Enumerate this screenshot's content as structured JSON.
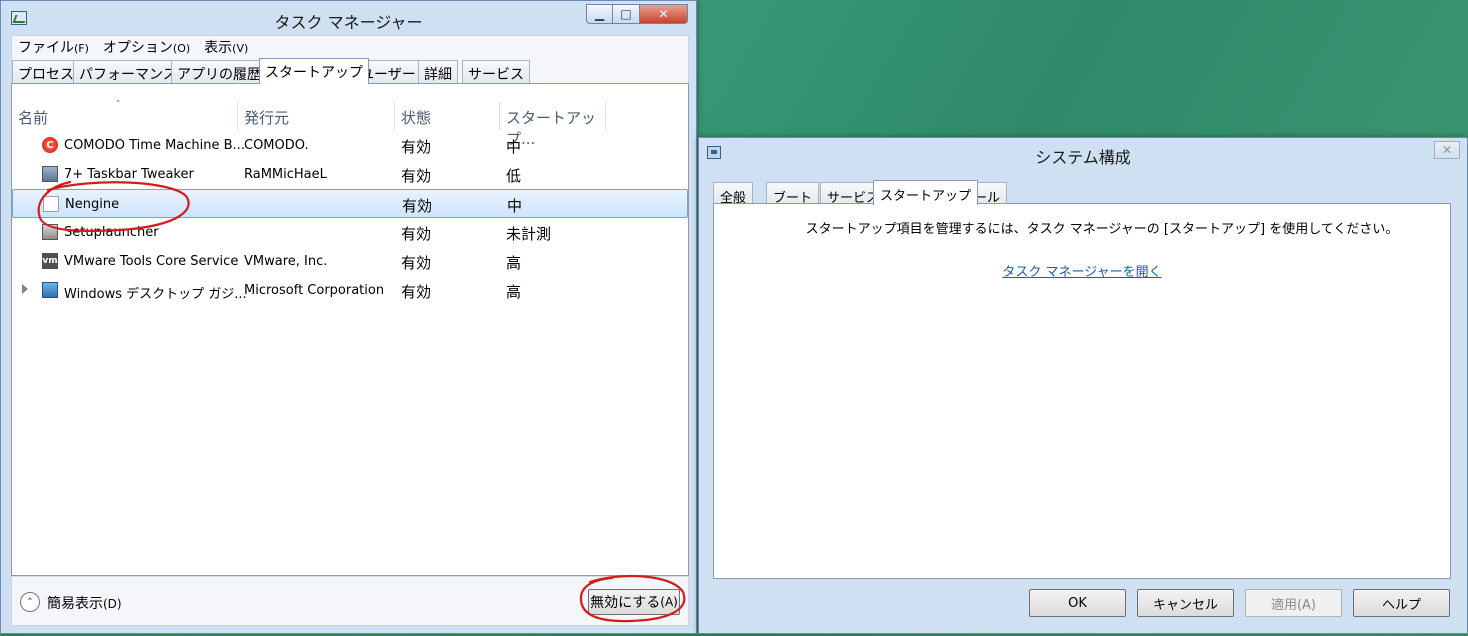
{
  "task_manager": {
    "title": "タスク マネージャー",
    "caption_buttons": {
      "minimize": "▁",
      "maximize": "□",
      "close": "✕"
    },
    "menu": [
      {
        "label": "ファイル",
        "accel": "(F)"
      },
      {
        "label": "オプション",
        "accel": "(O)"
      },
      {
        "label": "表示",
        "accel": "(V)"
      }
    ],
    "tabs": [
      "プロセス",
      "パフォーマンス",
      "アプリの履歴",
      "スタートアップ",
      "ユーザー",
      "詳細",
      "サービス"
    ],
    "active_tab": "スタートアップ",
    "columns": {
      "name": "名前",
      "publisher": "発行元",
      "status": "状態",
      "impact": "スタートアップ..."
    },
    "sort_indicator": "˄",
    "rows": [
      {
        "name": "COMODO Time Machine B...",
        "publisher": "COMODO.",
        "status": "有効",
        "impact": "中",
        "icon": "comodo-icon",
        "icon_glyph": "C"
      },
      {
        "name": "7+ Taskbar Tweaker",
        "publisher": "RaMMicHaeL",
        "status": "有効",
        "impact": "低",
        "icon": "taskbar-tweaker-icon",
        "icon_glyph": ""
      },
      {
        "name": "Nengine",
        "publisher": "",
        "status": "有効",
        "impact": "中",
        "icon": "file-icon",
        "icon_glyph": ""
      },
      {
        "name": "Setuplauncher",
        "publisher": "",
        "status": "有効",
        "impact": "未計測",
        "icon": "setup-launcher-icon",
        "icon_glyph": ""
      },
      {
        "name": "VMware Tools Core Service",
        "publisher": "VMware, Inc.",
        "status": "有効",
        "impact": "高",
        "icon": "vmware-icon",
        "icon_glyph": "vm"
      },
      {
        "name": "Windows デスクトップ ガジ...",
        "publisher": "Microsoft Corporation",
        "status": "有効",
        "impact": "高",
        "icon": "desktop-gadget-icon",
        "icon_glyph": ""
      }
    ],
    "selected_row_index": 2,
    "footer": {
      "fewer_details": "簡易表示",
      "fewer_details_accel": "(D)",
      "fewer_details_glyph": "˄",
      "disable_button": "無効にする",
      "disable_button_accel": "(A)"
    }
  },
  "system_config": {
    "title": "システム構成",
    "close_glyph": "✕",
    "tabs": [
      "全般",
      "ブート",
      "サービス",
      "スタートアップ",
      "ツール"
    ],
    "active_tab": "スタートアップ",
    "message": "スタートアップ項目を管理するには、タスク マネージャーの [スタートアップ] を使用してください。",
    "link": "タスク マネージャーを開く",
    "buttons": {
      "ok": "OK",
      "cancel": "キャンセル",
      "apply": "適用(A)",
      "help": "ヘルプ"
    }
  },
  "colors": {
    "annotation": "#d41c1c",
    "selection": "#cde5fb",
    "link": "#1c5ea8"
  }
}
